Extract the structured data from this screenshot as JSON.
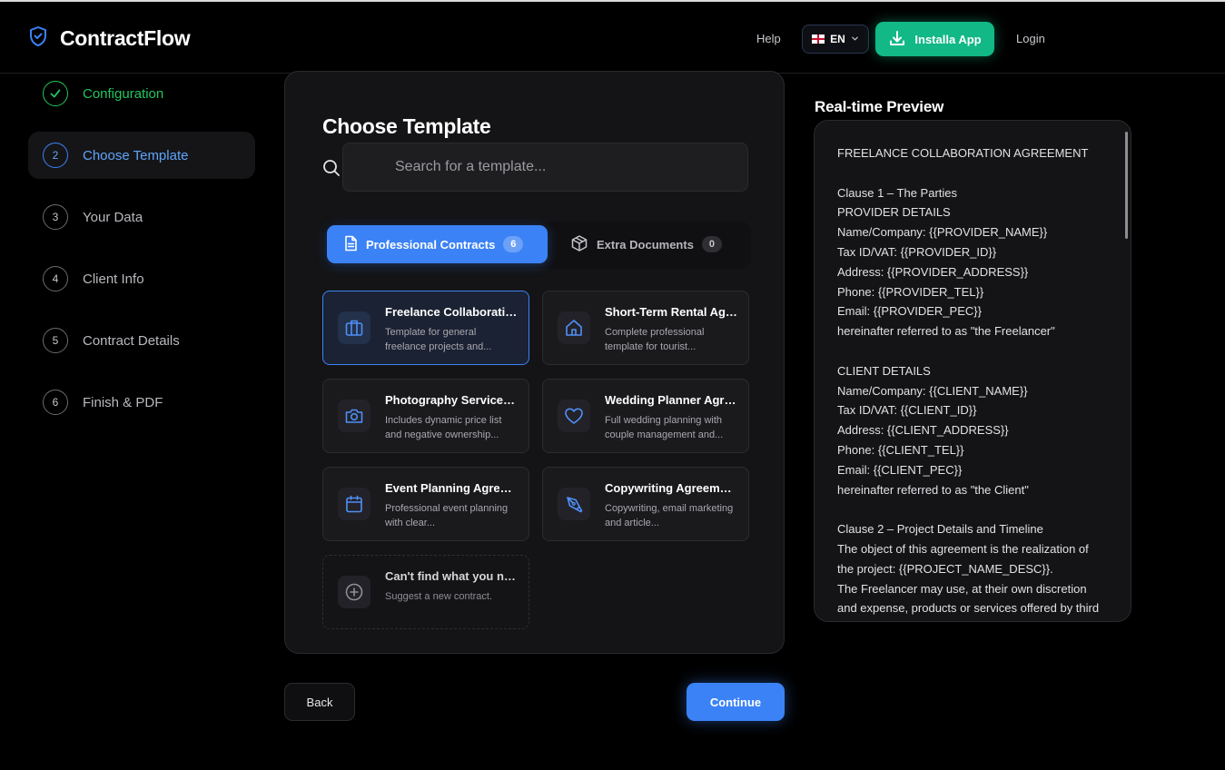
{
  "header": {
    "brand": "ContractFlow",
    "help": "Help",
    "language": "EN",
    "install": "Installa App",
    "login": "Login"
  },
  "steps": [
    {
      "num": "",
      "label": "Configuration",
      "state": "done"
    },
    {
      "num": "2",
      "label": "Choose Template",
      "state": "active"
    },
    {
      "num": "3",
      "label": "Your Data",
      "state": "pending"
    },
    {
      "num": "4",
      "label": "Client Info",
      "state": "pending"
    },
    {
      "num": "5",
      "label": "Contract Details",
      "state": "pending"
    },
    {
      "num": "6",
      "label": "Finish & PDF",
      "state": "pending"
    }
  ],
  "main": {
    "title": "Choose Template",
    "search_placeholder": "Search for a template...",
    "tabs": [
      {
        "label": "Professional Contracts",
        "count": "6"
      },
      {
        "label": "Extra Documents",
        "count": "0"
      }
    ],
    "templates": [
      {
        "title": "Freelance Collaboration Agreement",
        "desc": "Template for general freelance projects and...",
        "icon": "briefcase-icon"
      },
      {
        "title": "Short-Term Rental Agreement",
        "desc": "Complete professional template for tourist...",
        "icon": "home-icon"
      },
      {
        "title": "Photography Services Agreement",
        "desc": "Includes dynamic price list and negative ownership...",
        "icon": "camera-icon"
      },
      {
        "title": "Wedding Planner Agreement",
        "desc": "Full wedding planning with couple management and...",
        "icon": "heart-icon"
      },
      {
        "title": "Event Planning Agreement",
        "desc": "Professional event planning with clear...",
        "icon": "calendar-icon"
      },
      {
        "title": "Copywriting Agreement",
        "desc": "Copywriting, email marketing and article...",
        "icon": "pen-tool-icon"
      }
    ],
    "suggest": {
      "title": "Can't find what you need?",
      "desc": "Suggest a new contract."
    },
    "back": "Back",
    "continue": "Continue"
  },
  "preview": {
    "title": "Real-time Preview",
    "lines": [
      "FREELANCE COLLABORATION AGREEMENT",
      "",
      "Clause 1 – The Parties",
      "PROVIDER DETAILS",
      "Name/Company: {{PROVIDER_NAME}}",
      "Tax ID/VAT: {{PROVIDER_ID}}",
      "Address: {{PROVIDER_ADDRESS}}",
      "Phone: {{PROVIDER_TEL}}",
      "Email: {{PROVIDER_PEC}}",
      "hereinafter referred to as \"the Freelancer\"",
      "",
      "CLIENT DETAILS",
      "Name/Company: {{CLIENT_NAME}}",
      "Tax ID/VAT: {{CLIENT_ID}}",
      "Address: {{CLIENT_ADDRESS}}",
      "Phone: {{CLIENT_TEL}}",
      "Email: {{CLIENT_PEC}}",
      "hereinafter referred to as \"the Client\"",
      "",
      "Clause 2 – Project Details and Timeline",
      "The object of this agreement is the realization of",
      "the project: {{PROJECT_NAME_DESC}}.",
      "The Freelancer may use, at their own discretion",
      "and expense, products or services offered by third"
    ]
  },
  "colors": {
    "accent": "#3b82f6",
    "success": "#22c55e",
    "install": "#12b886",
    "background": "#000000"
  }
}
